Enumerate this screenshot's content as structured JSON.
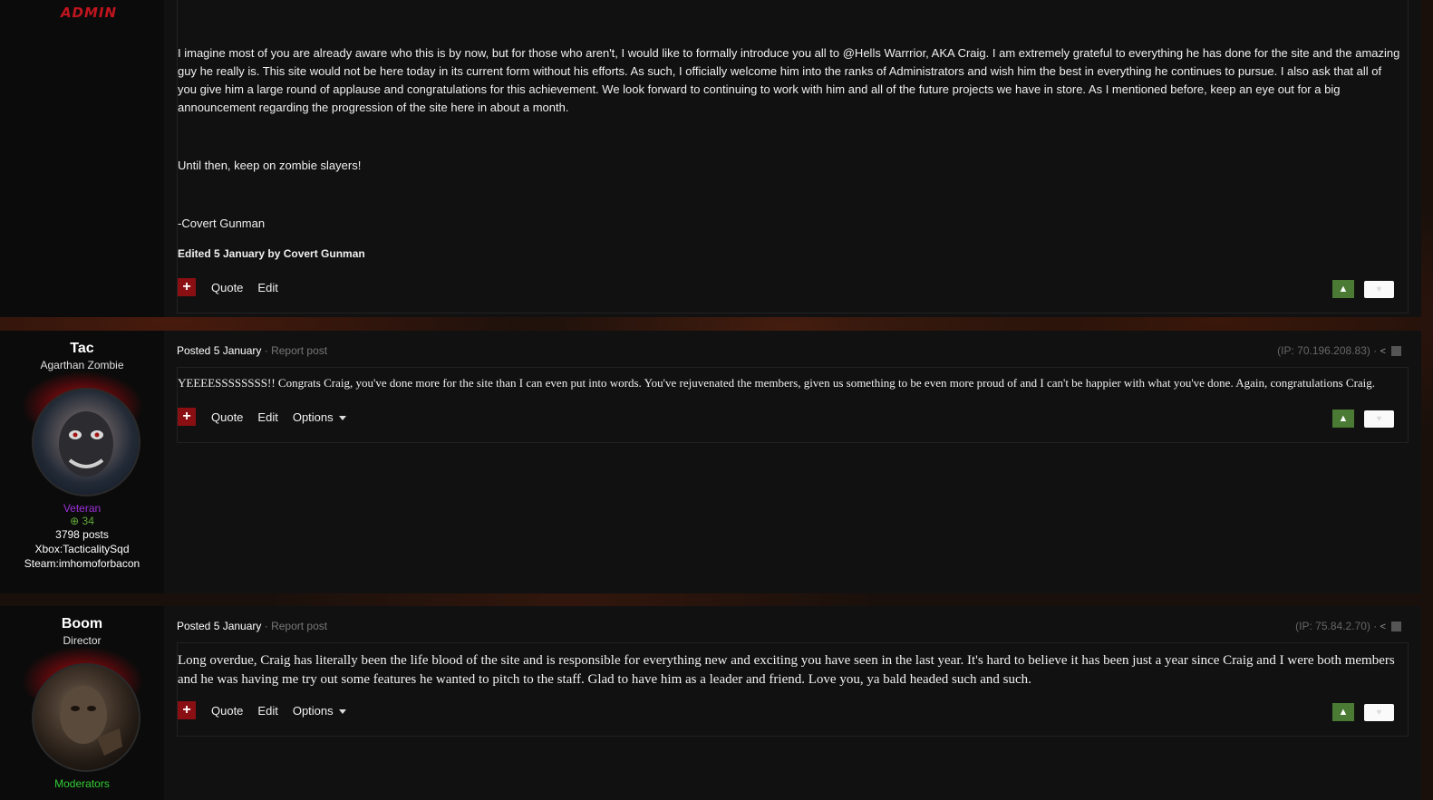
{
  "post1": {
    "author_badge": "ADMIN",
    "paragraph1": "I imagine most of you are already aware who this is by now, but for those who aren't, I would like to formally introduce you all to @Hells Warrrior, AKA Craig. I am extremely grateful to everything he has done for the site and the amazing guy he really is. This site would not be here today in its current form without his efforts. As such, I officially welcome him into the ranks of Administrators and wish him the best in everything he continues to pursue. I also ask that all of you give him a large round of applause and congratulations for this achievement. We look forward to continuing to work with him and all of the future projects we have in store. As I mentioned before, keep an eye out for a big announcement regarding the progression of the site here in about a month.",
    "paragraph2": "Until then, keep on zombie slayers!",
    "signature": "-Covert Gunman",
    "edited": "Edited 5 January by Covert Gunman",
    "actions": {
      "plus": "+",
      "quote": "Quote",
      "edit": "Edit"
    }
  },
  "post2": {
    "author": {
      "name": "Tac",
      "title": "Agarthan Zombie",
      "group": "Veteran",
      "reputation": "34",
      "posts": "3798 posts",
      "xbox": "Xbox:TacticalitySqd",
      "steam": "Steam:imhomoforbacon"
    },
    "posted_label": "Posted 5 January",
    "separator": " · ",
    "report": "Report post",
    "ip": "(IP: 70.196.208.83) ·",
    "body": "YEEEESSSSSSSS!! Congrats Craig, you've done more for the site than I can even put into words. You've rejuvenated the members, given us something to be even more proud of and I can't be happier with what you've done. Again, congratulations Craig.",
    "actions": {
      "plus": "+",
      "quote": "Quote",
      "edit": "Edit",
      "options": "Options"
    }
  },
  "post3": {
    "author": {
      "name": "Boom",
      "title": "Director",
      "group": "Moderators"
    },
    "posted_label": "Posted 5 January",
    "separator": " · ",
    "report": "Report post",
    "ip": "(IP: 75.84.2.70) ·",
    "body": "Long overdue, Craig has literally been the life blood of the site and is responsible for everything new and exciting you have seen in the last year. It's hard to believe it has been just a year since Craig and I were both members and he was having me try out some features he wanted to pitch to the staff. Glad to have him as a leader and friend. Love you, ya bald headed such and such.",
    "actions": {
      "plus": "+",
      "quote": "Quote",
      "edit": "Edit",
      "options": "Options"
    }
  },
  "colors": {
    "accent_red": "#8a0f12",
    "upvote_green": "#4a7a33",
    "veteran_purple": "#9b30d9",
    "moderator_green": "#33cc33"
  },
  "icons": [
    "plus-icon",
    "upvote-arrow-icon",
    "heart-icon",
    "share-icon",
    "caret-down-icon",
    "reputation-plus-icon"
  ]
}
